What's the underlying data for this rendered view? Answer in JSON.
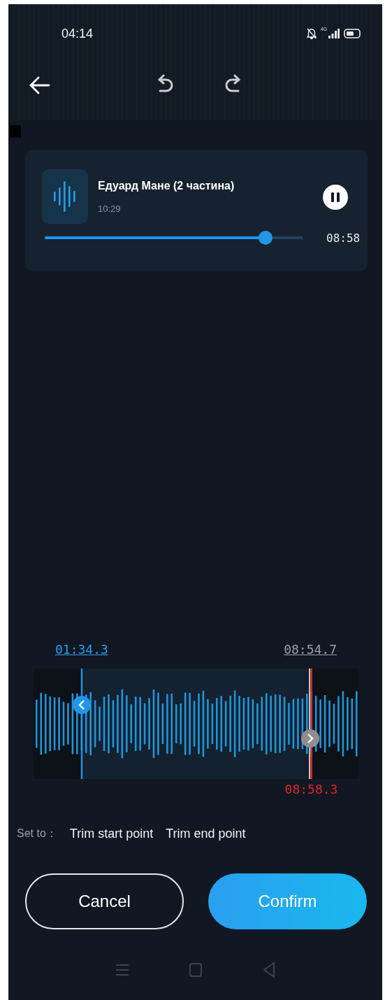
{
  "status_bar": {
    "time": "04:14",
    "network": "4G"
  },
  "track": {
    "title": "Едуард Мане (2 частина)",
    "duration": "10:29",
    "playing": true,
    "level": 0.856,
    "position": "08:58"
  },
  "trim": {
    "start": {
      "time": "01:34.3",
      "level": 0.148
    },
    "end": {
      "time": "08:54.7",
      "level": 0.85
    },
    "playhead": {
      "time": "08:58.3",
      "level": 0.853
    }
  },
  "set_to": {
    "label": "Set to：",
    "options": [
      "Trim start point",
      "Trim end point"
    ]
  },
  "buttons": [
    {
      "label": "Cancel",
      "kind": "outline"
    },
    {
      "label": "Confirm",
      "kind": "primary"
    }
  ]
}
